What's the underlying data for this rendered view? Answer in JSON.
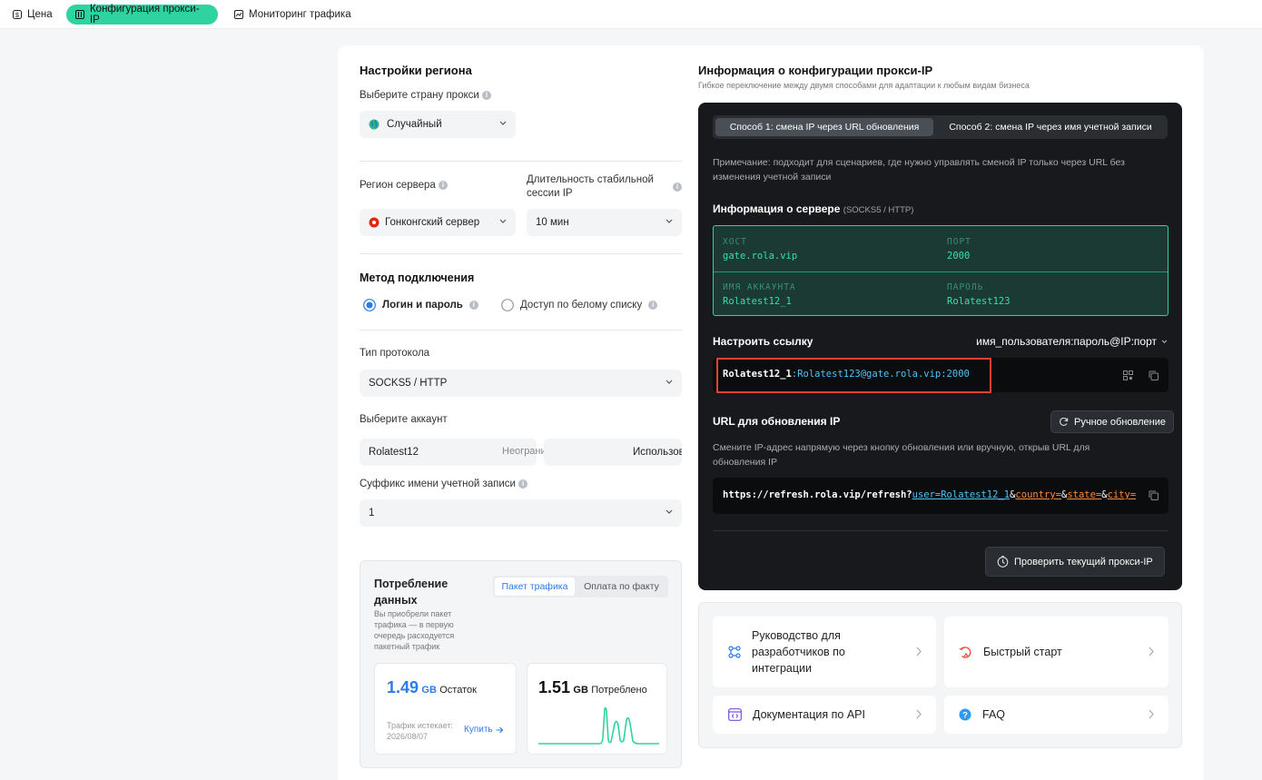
{
  "nav": {
    "tabs": [
      {
        "label": "Цена",
        "icon": "price-tag-icon"
      },
      {
        "label": "Конфигурация прокси-IP",
        "icon": "config-icon"
      },
      {
        "label": "Мониторинг трафика",
        "icon": "chart-icon"
      }
    ],
    "active_tab": 1
  },
  "region": {
    "title": "Настройки региона",
    "country_label": "Выберите страну прокси",
    "country_value": "Случайный",
    "server_region_label": "Регион сервера",
    "server_region_value": "Гонконгский сервер",
    "session_label": "Длительность стабильной сессии IP",
    "session_value": "10 мин"
  },
  "connection": {
    "title": "Метод подключения",
    "options": [
      "Логин и пароль",
      "Доступ по белому списку"
    ],
    "selected": 0
  },
  "protocol": {
    "label": "Тип протокола",
    "value": "SOCKS5 / HTTP"
  },
  "account": {
    "label": "Выберите аккаунт",
    "value": "Rolatest12",
    "traffic": "Неограниченный трафик",
    "used": "Использовано"
  },
  "suffix": {
    "label": "Суффикс имени учетной записи",
    "value": "1"
  },
  "consumption": {
    "title": "Потребление данных",
    "tabs": [
      "Пакет трафика",
      "Оплата по факту"
    ],
    "active_tab": 0,
    "description": "Вы приобрели пакет трафика — в первую очередь расходуется пакетный трафик",
    "remaining_value": "1.49",
    "remaining_unit": "GB",
    "remaining_label": "Остаток",
    "expiry_label": "Трафик истекает:",
    "expiry_date": "2026/08/07",
    "buy_label": "Купить",
    "used_value": "1.51",
    "used_unit": "GB",
    "used_label": "Потреблено"
  },
  "proxy_info": {
    "title": "Информация о конфигурации прокси-IP",
    "subtitle": "Гибкое переключение между двумя способами для адаптации к любым видам бизнеса",
    "methods": [
      "Способ 1: смена IP через URL обновления",
      "Способ 2: смена IP через имя учетной записи"
    ],
    "active_method": 0,
    "note": "Примечание: подходит для сценариев, где нужно управлять сменой IP только через URL без изменения учетной записи",
    "server_title": "Информация о сервере",
    "server_protocol": "(SOCKS5 / HTTP)",
    "host_key": "ХОСТ",
    "host_value": "gate.rola.vip",
    "port_key": "ПОРТ",
    "port_value": "2000",
    "account_key": "ИМЯ АККАУНТА",
    "account_value": "Rolatest12_1",
    "password_key": "ПАРОЛЬ",
    "password_value": "Rolatest123",
    "link_title": "Настроить ссылку",
    "link_format": "имя_пользователя:пароль@IP:порт",
    "link_user": "Rolatest12_1",
    "link_sep": ":",
    "link_rest": "Rolatest123@gate.rola.vip:2000",
    "refresh_title": "URL для обновления IP",
    "manual_refresh": "Ручное обновление",
    "refresh_desc": "Смените IP-адрес напрямую через кнопку обновления или вручную, открыв URL для обновления IP",
    "refresh_url_base": "https://refresh.rola.vip/refresh?",
    "refresh_url_user": "user=Rolatest12_1",
    "refresh_url_amp1": "&",
    "refresh_url_country": "country=",
    "refresh_url_amp2": "&",
    "refresh_url_state": "state=",
    "refresh_url_amp3": "&",
    "refresh_url_city": "city=",
    "check_button": "Проверить текущий прокси-IP"
  },
  "links": [
    {
      "label": "Руководство для разработчиков по интеграции",
      "icon": "integration-icon"
    },
    {
      "label": "Быстрый старт",
      "icon": "quickstart-icon"
    },
    {
      "label": "Документация по API",
      "icon": "api-doc-icon"
    },
    {
      "label": "FAQ",
      "icon": "faq-icon"
    }
  ],
  "colors": {
    "accent": "#2fd3a0",
    "link_blue": "#2d7be5",
    "code_blue": "#4fc3f7",
    "code_orange": "#ff8a3d",
    "highlight_red": "#e0432e"
  }
}
